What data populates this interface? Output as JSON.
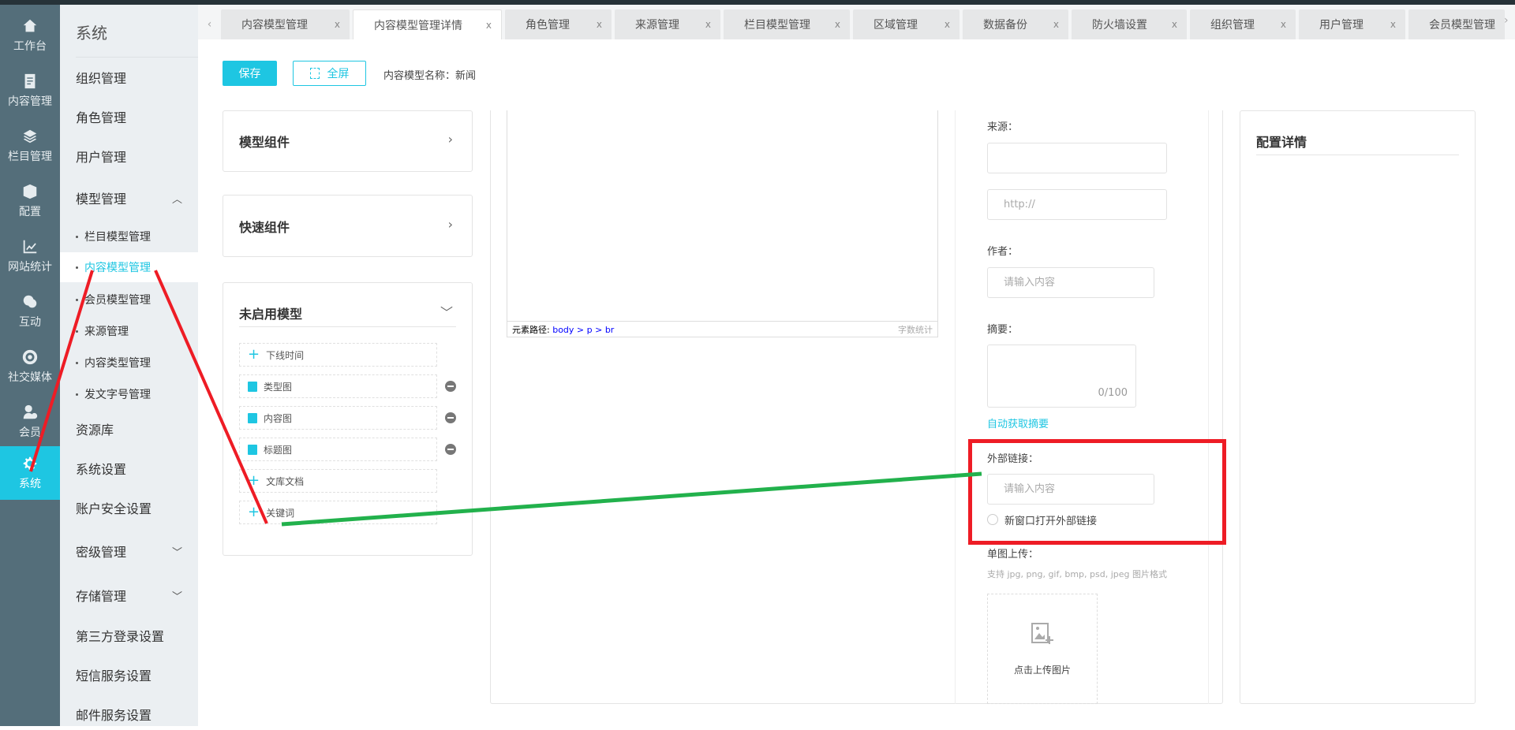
{
  "icon_sidebar": [
    {
      "label": "工作台",
      "icon": "home-icon"
    },
    {
      "label": "内容管理",
      "icon": "document-icon"
    },
    {
      "label": "栏目管理",
      "icon": "layers-icon"
    },
    {
      "label": "配置",
      "icon": "box-icon"
    },
    {
      "label": "网站统计",
      "icon": "chart-icon"
    },
    {
      "label": "互动",
      "icon": "chat-icon"
    },
    {
      "label": "社交媒体",
      "icon": "target-icon"
    },
    {
      "label": "会员",
      "icon": "member-icon"
    },
    {
      "label": "系统",
      "icon": "gear-icon",
      "active": true
    }
  ],
  "nav": {
    "title": "系统",
    "items": [
      "组织管理",
      "角色管理",
      "用户管理",
      "模型管理"
    ],
    "sub_items": [
      "栏目模型管理",
      "内容模型管理",
      "会员模型管理",
      "来源管理",
      "内容类型管理",
      "发文字号管理"
    ],
    "items2": [
      "资源库",
      "系统设置",
      "账户安全设置",
      "密级管理",
      "存储管理",
      "第三方登录设置",
      "短信服务设置",
      "邮件服务设置"
    ]
  },
  "tabs": [
    "内容模型管理",
    "内容模型管理详情",
    "角色管理",
    "来源管理",
    "栏目模型管理",
    "区域管理",
    "数据备份",
    "防火墙设置",
    "组织管理",
    "用户管理",
    "会员模型管理"
  ],
  "tab_close": "x",
  "toolbar": {
    "save": "保存",
    "fullscreen": "全屏",
    "model_name": "内容模型名称：新闻"
  },
  "panels": {
    "model_components": "模型组件",
    "quick_components": "快速组件",
    "disabled_models": "未启用模型"
  },
  "disabled_fields": [
    {
      "label": "下线时间",
      "type": "plus"
    },
    {
      "label": "类型图",
      "type": "image"
    },
    {
      "label": "内容图",
      "type": "image"
    },
    {
      "label": "标题图",
      "type": "image"
    },
    {
      "label": "文库文档",
      "type": "plus"
    },
    {
      "label": "关键词",
      "type": "plus"
    }
  ],
  "editor": {
    "path_label": "元素路径:",
    "path": "body > p > br",
    "word_count": "字数统计"
  },
  "form": {
    "source_label": "来源：",
    "source_url_placeholder": "http://",
    "author_label": "作者：",
    "author_placeholder": "请输入内容",
    "summary_label": "摘要：",
    "summary_counter": "0/100",
    "auto_summary": "自动获取摘要",
    "external_link_label": "外部链接：",
    "external_link_placeholder": "请输入内容",
    "new_window": "新窗口打开外部链接",
    "upload_label": "单图上传：",
    "upload_hint": "支持 jpg, png, gif, bmp, psd, jpeg 图片格式",
    "upload_button": "点击上传图片"
  },
  "config": {
    "title": "配置详情"
  },
  "colors": {
    "accent": "#1ec6e2",
    "annotation_red": "#ee1c25",
    "annotation_green": "#22b14c"
  }
}
